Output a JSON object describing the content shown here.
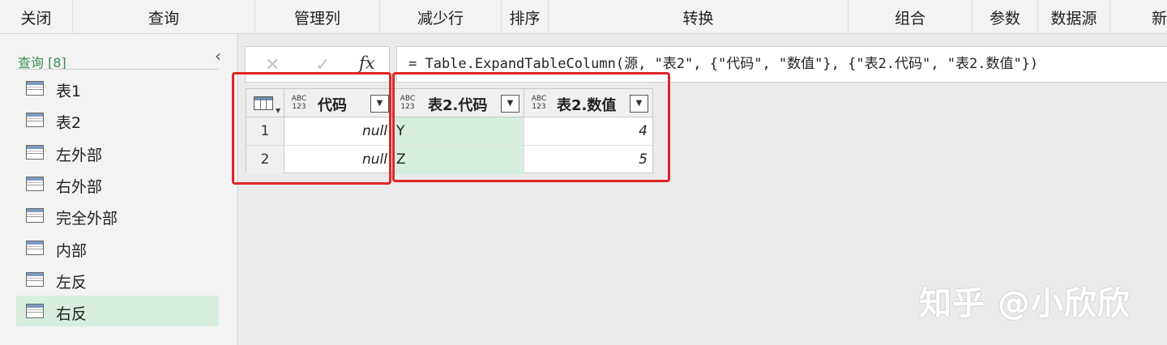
{
  "ribbon": {
    "groups": [
      {
        "name": "ribbon-close",
        "label": "关闭"
      },
      {
        "name": "ribbon-query",
        "label": "查询"
      },
      {
        "name": "ribbon-manage-columns",
        "label": "管理列"
      },
      {
        "name": "ribbon-reduce-rows",
        "label": "减少行"
      },
      {
        "name": "ribbon-sort",
        "label": "排序"
      },
      {
        "name": "ribbon-transform",
        "label": "转换"
      },
      {
        "name": "ribbon-combine",
        "label": "组合"
      },
      {
        "name": "ribbon-parameters",
        "label": "参数"
      },
      {
        "name": "ribbon-data-source",
        "label": "数据源"
      },
      {
        "name": "ribbon-new",
        "label": "新"
      }
    ]
  },
  "queries": {
    "header": "查询 [8]",
    "collapse_icon": "‹",
    "items": [
      "表1",
      "表2",
      "左外部",
      "右外部",
      "完全外部",
      "内部",
      "左反",
      "右反"
    ],
    "selected": "右反"
  },
  "formula": {
    "cancel_icon": "✕",
    "accept_icon": "✓",
    "fx_label": "fx",
    "expression": "= Table.ExpandTableColumn(源, \"表2\", {\"代码\", \"数值\"}, {\"表2.代码\", \"表2.数值\"})"
  },
  "grid": {
    "columns": [
      {
        "name": "代码",
        "type_top": "ABC",
        "type_bottom": "123"
      },
      {
        "name": "表2.代码",
        "type_top": "ABC",
        "type_bottom": "123"
      },
      {
        "name": "表2.数值",
        "type_top": "ABC",
        "type_bottom": "123"
      }
    ],
    "rows": [
      {
        "index": "1",
        "cells": [
          "null",
          "Y",
          "4"
        ]
      },
      {
        "index": "2",
        "cells": [
          "null",
          "Z",
          "5"
        ]
      }
    ],
    "dropdown_glyph": "▼",
    "corner_caret": "▼"
  },
  "watermark": "知乎 @小欣欣",
  "colors": {
    "highlight_green": "#d7eedf",
    "annotation_red": "#e02626",
    "query_header_green": "#3d8e4f"
  }
}
